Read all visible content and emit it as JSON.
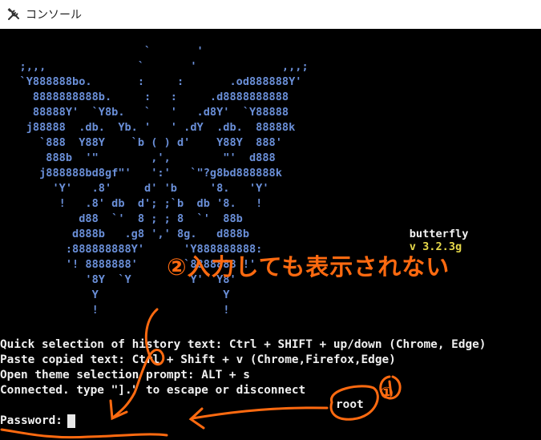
{
  "window": {
    "title": "コンソール",
    "icon": "tools-icon"
  },
  "terminal": {
    "ascii_art": [
      "                      `       '",
      "   ;,,,              `       '             ,,,;",
      "   `Y888888bo.       :     :       .od888888Y'",
      "     8888888888b.     :   :     .d8888888888",
      "     88888Y'  `Y8b.   `   '   .d8Y'  `Y88888",
      "    j88888  .db.  Yb. '   ' .dY  .db.  88888k",
      "      `888  Y88Y    `b ( ) d'    Y88Y  888'",
      "       888b  '\"        ,',        \"'  d888",
      "      j888888bd8gf\"'   ':'   `\"?g8bd888888k",
      "        'Y'   .8'     d' 'b     '8.   'Y'",
      "         !   .8' db  d'; ;`b  db '8.   !",
      "            d88  `'  8 ; ; 8  `'  88b",
      "           d888b   .g8 ',' 8g.   d888b",
      "          :888888888Y'      'Y888888888:",
      "          '! 8888888'       `8888888 !'",
      "             '8Y  `Y         Y'  Y8'",
      "              Y                   Y",
      "              !                   !"
    ],
    "brand_name": "butterfly",
    "brand_version": "v 3.2.3g",
    "info_lines": [
      "Quick selection of history text: Ctrl + SHIFT + up/down (Chrome, Edge)",
      "Paste copied text: Ctrl + Shift + v (Chrome,Firefox,Edge)",
      "Open theme selection prompt: ALT + s",
      "Connected. type \"].\" to escape or disconnect"
    ],
    "prompt_label": "Password:"
  },
  "annotations": {
    "note_main": "②入力しても表示されない",
    "note_marker_1": "①",
    "note_root": "root",
    "color": "#ff6a10"
  }
}
